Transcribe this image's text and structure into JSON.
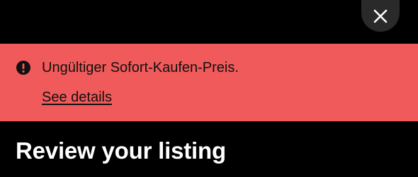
{
  "header": {
    "close_icon": "close-icon"
  },
  "alert": {
    "icon": "alert-circle-icon",
    "message": "Ungültiger Sofort-Kaufen-Preis.",
    "link_label": "See details",
    "background_color": "#f15a5a"
  },
  "page": {
    "title": "Review your listing",
    "background_color": "#000000"
  }
}
